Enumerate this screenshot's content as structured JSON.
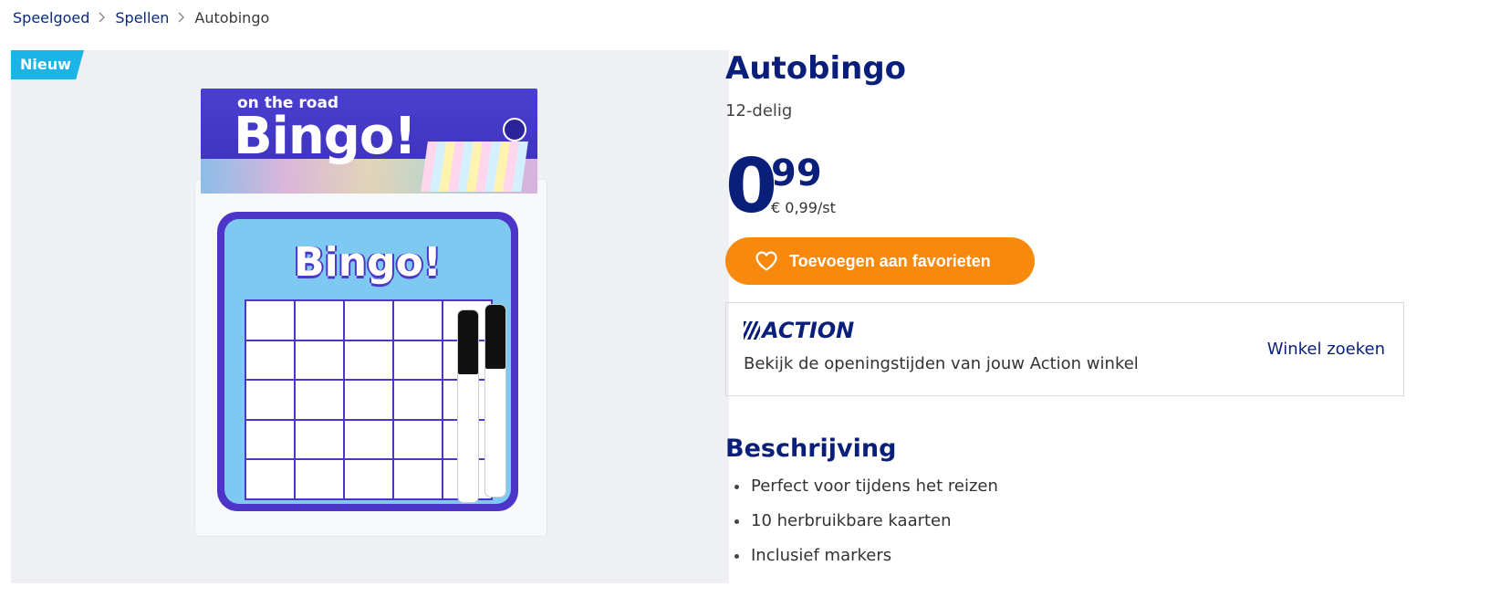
{
  "breadcrumb": {
    "items": [
      {
        "label": "Speelgoed"
      },
      {
        "label": "Spellen"
      },
      {
        "label": "Autobingo"
      }
    ]
  },
  "image": {
    "badge": "Nieuw",
    "packaging_text_small": "on the road",
    "packaging_text_large": "Bingo!",
    "board_title": "Bingo!"
  },
  "product": {
    "title": "Autobingo",
    "subtitle": "12-delig",
    "price_integer": "0",
    "price_decimals": "99",
    "unit_price": "€ 0,99/st",
    "favorite_button_label": "Toevoegen aan favorieten"
  },
  "store": {
    "logo_text": "ACTION",
    "text": "Bekijk de openingstijden van jouw Action winkel",
    "link_label": "Winkel zoeken"
  },
  "description": {
    "title": "Beschrijving",
    "items": [
      "Perfect voor tijdens het reizen",
      "10 herbruikbare kaarten",
      "Inclusief markers"
    ]
  },
  "colors": {
    "brand_blue": "#0a1f7a",
    "button_orange": "#f7890f",
    "badge_blue": "#1cb3e6"
  }
}
